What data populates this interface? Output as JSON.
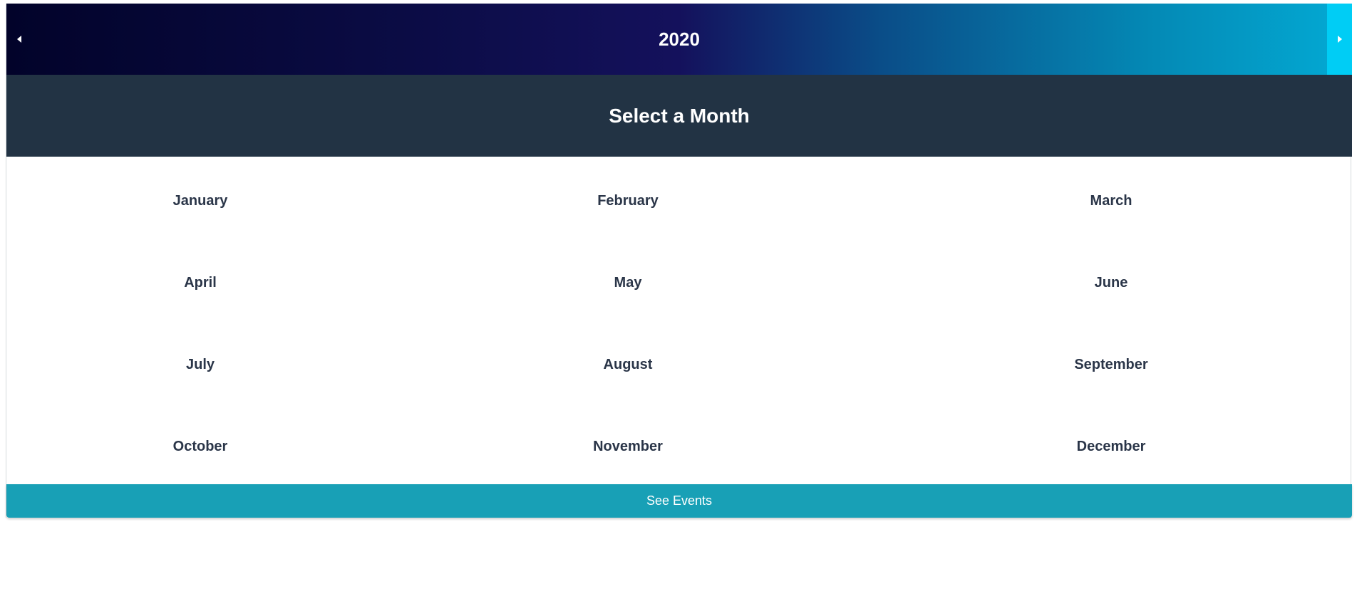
{
  "year_bar": {
    "year": "2020",
    "prev_icon": "caret-left-icon",
    "next_icon": "caret-right-icon",
    "gradient_colors": [
      "#02032a",
      "#14115c",
      "#0489b5",
      "#03aad4"
    ],
    "next_button_color": "#00cdf5"
  },
  "header": {
    "title": "Select a Month",
    "background": "#223344"
  },
  "months": [
    "January",
    "February",
    "March",
    "April",
    "May",
    "June",
    "July",
    "August",
    "September",
    "October",
    "November",
    "December"
  ],
  "footer": {
    "see_events_label": "See Events",
    "button_color": "#18a0b6"
  }
}
